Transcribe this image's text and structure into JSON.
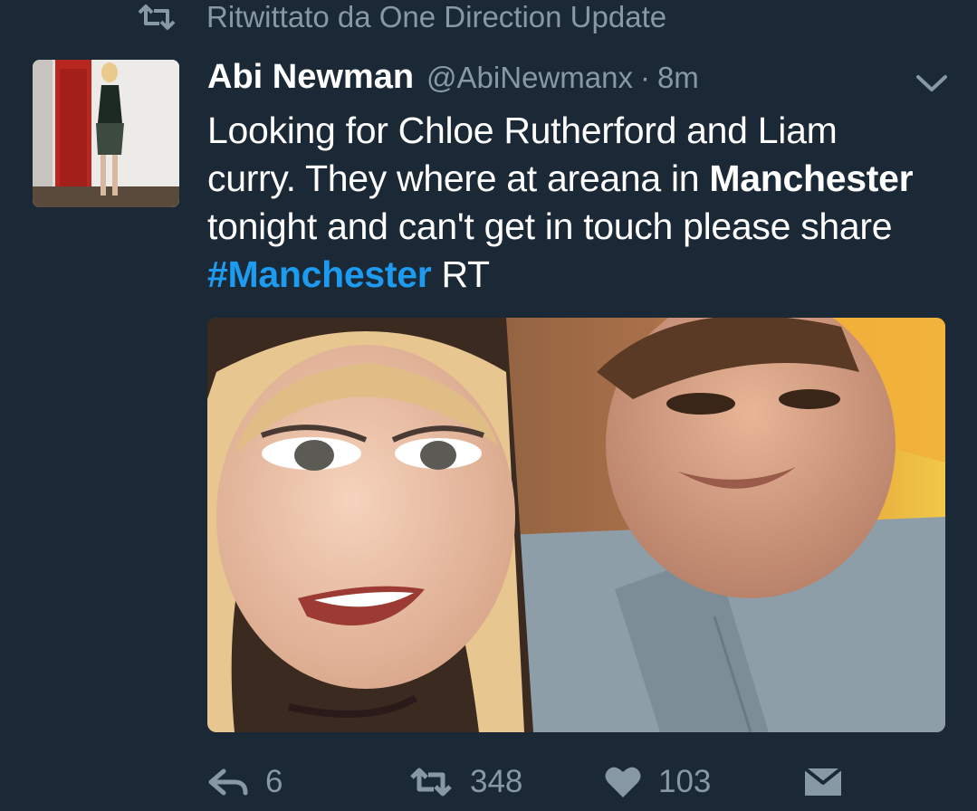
{
  "retweet_context": {
    "icon": "retweet-icon",
    "text": "Ritwittato da One Direction Update"
  },
  "tweet": {
    "display_name": "Abi Newman",
    "handle": "@AbiNewmanx",
    "separator": "·",
    "time": "8m",
    "text": {
      "part1": "Looking for Chloe Rutherford and Liam curry. They where at areana in ",
      "bold1": "Manchester",
      "part2": " tonight and can't get in touch please share ",
      "hashtag": "#Manchester",
      "part3": " RT"
    },
    "media_description": "Selfie photo of a young woman and man"
  },
  "actions": {
    "reply": {
      "icon": "reply-icon",
      "count": "6"
    },
    "retweet": {
      "icon": "retweet-icon",
      "count": "348"
    },
    "like": {
      "icon": "heart-icon",
      "count": "103"
    },
    "dm": {
      "icon": "envelope-icon"
    }
  },
  "colors": {
    "background": "#1b2836",
    "secondary_text": "#8899a6",
    "hashtag": "#1d9bf0"
  }
}
